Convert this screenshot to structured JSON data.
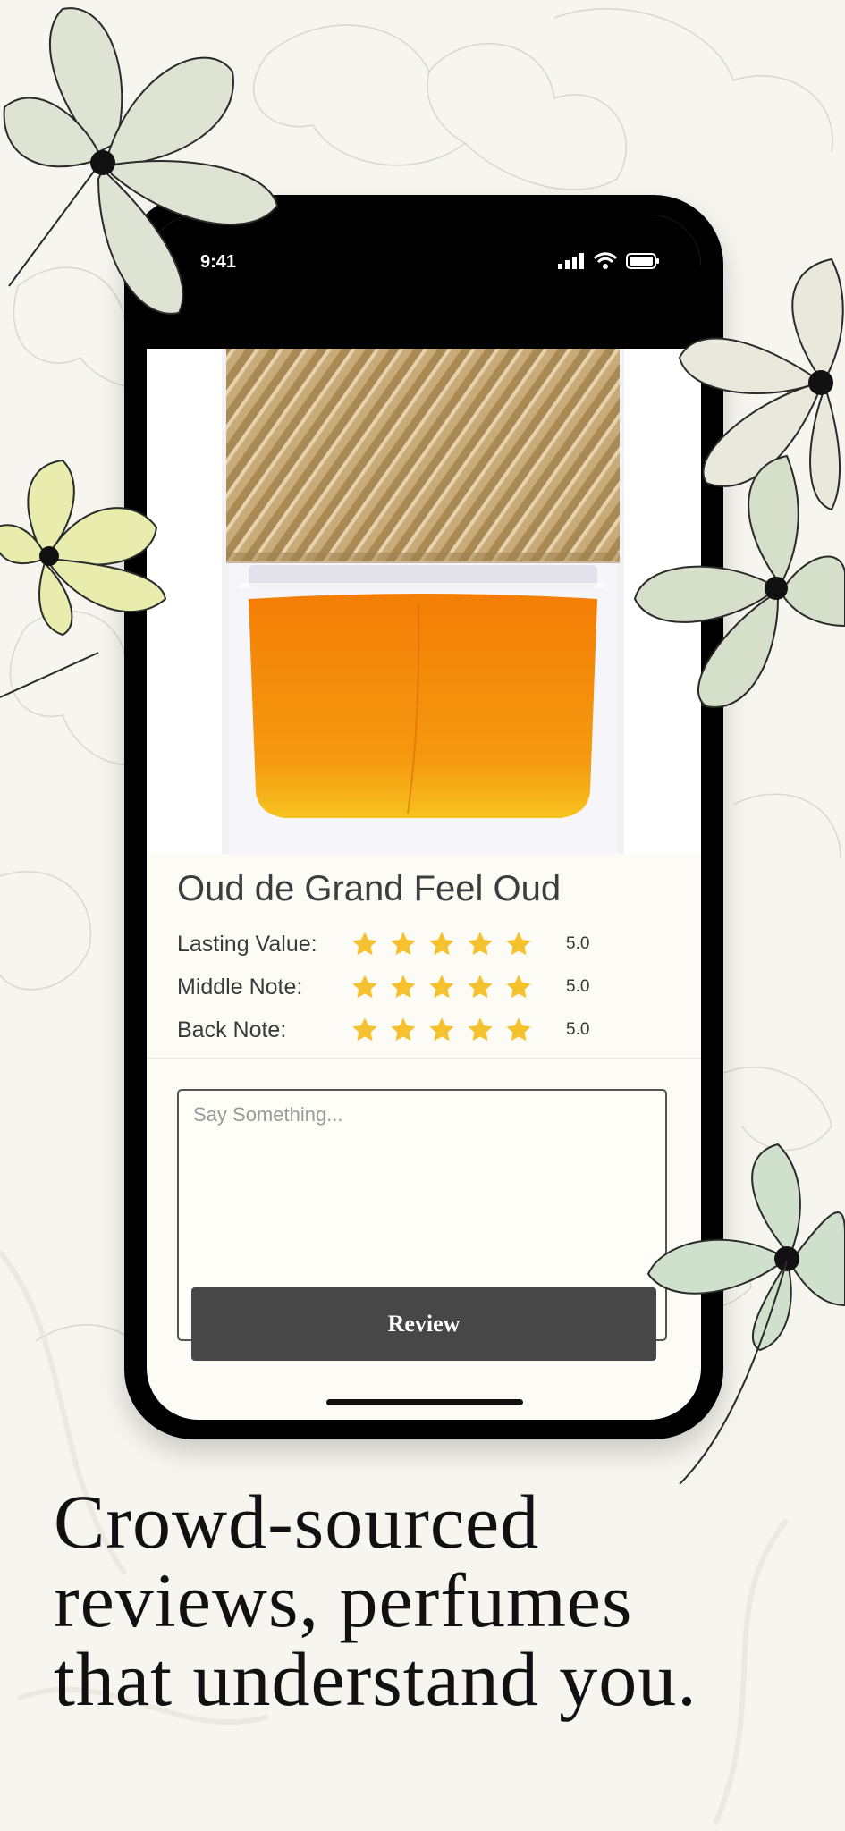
{
  "status_bar": {
    "time": "9:41"
  },
  "product": {
    "title": "Oud de Grand Feel Oud",
    "ratings": [
      {
        "label": "Lasting Value:",
        "stars": 5,
        "value": "5.0"
      },
      {
        "label": "Middle Note:",
        "stars": 5,
        "value": "5.0"
      },
      {
        "label": "Back Note:",
        "stars": 5,
        "value": "5.0"
      }
    ]
  },
  "review": {
    "placeholder": "Say Something...",
    "button_label": "Review"
  },
  "headline": {
    "line1": "Crowd-sourced",
    "line2": "reviews, perfumes",
    "line3": "that understand you."
  },
  "colors": {
    "background": "#f7f5ef",
    "star": "#f6c12f",
    "button": "#474747",
    "liquid": "#f28a0a"
  }
}
